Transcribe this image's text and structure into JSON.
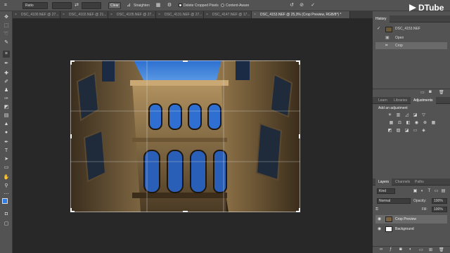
{
  "options_bar": {
    "ratio_label": "Ratio",
    "clear_label": "Clear",
    "straighten_label": "Straighten",
    "delete_cropped_label": "Delete Cropped Pixels",
    "content_aware_label": "Content-Aware"
  },
  "tabs": [
    {
      "label": "DSC_4100.NEF @ 27..."
    },
    {
      "label": "DSC_4102.NEF @ 21..."
    },
    {
      "label": "DSC_4105.NEF @ 27..."
    },
    {
      "label": "DSC_4131.NEF @ 27..."
    },
    {
      "label": "DSC_4147.NEF @ 17..."
    },
    {
      "label": "DSC_4153.NEF @ 25,3% (Crop Preview, RGB/8*) *"
    }
  ],
  "watermark": {
    "text": "DTube"
  },
  "history": {
    "title": "History",
    "snapshot": "DSC_4153.NEF",
    "items": [
      {
        "label": "Open"
      },
      {
        "label": "Crop"
      }
    ]
  },
  "adjustments": {
    "tabs": [
      {
        "label": "Learn"
      },
      {
        "label": "Libraries"
      },
      {
        "label": "Adjustments"
      }
    ],
    "add_label": "Add an adjustment"
  },
  "layers": {
    "tabs": [
      {
        "label": "Layers"
      },
      {
        "label": "Channels"
      },
      {
        "label": "Paths"
      }
    ],
    "kind_placeholder": "Kind",
    "blend_mode": "Normal",
    "opacity_label": "Opacity:",
    "opacity_value": "100%",
    "fill_label": "Fill:",
    "fill_value": "100%",
    "items": [
      {
        "label": "Crop Preview"
      },
      {
        "label": "Background"
      }
    ]
  },
  "colors": {
    "accent": "#2d7be5",
    "panel_bg": "#535353",
    "canvas_bg": "#282828"
  }
}
